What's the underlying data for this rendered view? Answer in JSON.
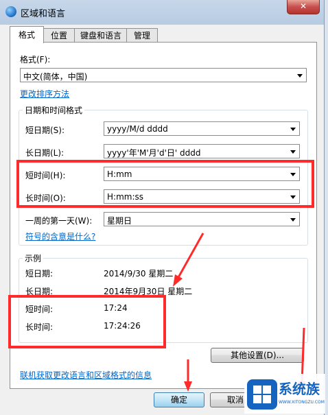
{
  "window": {
    "title": "区域和语言",
    "close_glyph": "✕"
  },
  "tabs": [
    "格式",
    "位置",
    "键盘和语言",
    "管理"
  ],
  "format": {
    "label": "格式(F):",
    "value": "中文(简体，中国)",
    "link": "更改排序方法"
  },
  "datetime": {
    "legend": "日期和时间格式",
    "rows": [
      {
        "label": "短日期(S):",
        "value": "yyyy/M/d dddd"
      },
      {
        "label": "长日期(L):",
        "value": "yyyy'年'M'月'd'日' dddd"
      },
      {
        "label": "短时间(H):",
        "value": "H:mm"
      },
      {
        "label": "长时间(O):",
        "value": "H:mm:ss"
      },
      {
        "label": "一周的第一天(W):",
        "value": "星期日"
      }
    ],
    "link": "符号的含意是什么?"
  },
  "examples": {
    "legend": "示例",
    "rows": [
      {
        "label": "短日期:",
        "value": "2014/9/30 星期二"
      },
      {
        "label": "长日期:",
        "value": "2014年9月30日 星期二"
      },
      {
        "label": "短时间:",
        "value": "17:24"
      },
      {
        "label": "长时间:",
        "value": "17:24:26"
      }
    ]
  },
  "other_settings_button": "其他设置(D)...",
  "online_link": "联机获取更改语言和区域格式的信息",
  "buttons": {
    "ok": "确定",
    "cancel": "取消"
  },
  "watermark": {
    "text": "系统族",
    "url": "WWW.XITONGZU.COM"
  },
  "colors": {
    "annotation_red": "#ff2a2a",
    "link_blue": "#0066cc"
  }
}
